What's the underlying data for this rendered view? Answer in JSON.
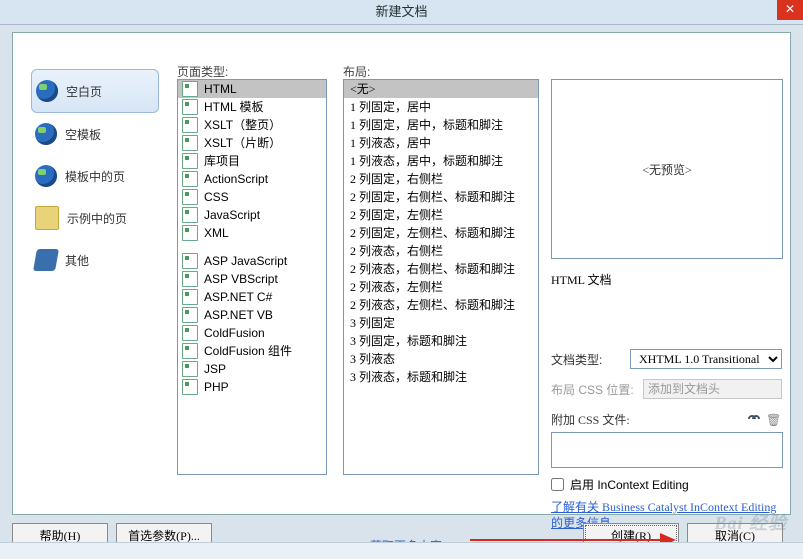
{
  "title": "新建文档",
  "categories": [
    {
      "label": "空白页",
      "icon": "globe",
      "selected": true
    },
    {
      "label": "空模板",
      "icon": "globe",
      "selected": false
    },
    {
      "label": "模板中的页",
      "icon": "globe",
      "selected": false
    },
    {
      "label": "示例中的页",
      "icon": "folder",
      "selected": false
    },
    {
      "label": "其他",
      "icon": "other",
      "selected": false
    }
  ],
  "pageTypeHeader": "页面类型:",
  "layoutHeader": "布局:",
  "pageTypes": {
    "group1": [
      "HTML",
      "HTML 模板",
      "XSLT（整页）",
      "XSLT（片断）",
      "库项目",
      "ActionScript",
      "CSS",
      "JavaScript",
      "XML"
    ],
    "group2": [
      "ASP JavaScript",
      "ASP VBScript",
      "ASP.NET C#",
      "ASP.NET VB",
      "ColdFusion",
      "ColdFusion 组件",
      "JSP",
      "PHP"
    ],
    "selected": "HTML"
  },
  "layouts": [
    "<无>",
    "1 列固定，居中",
    "1 列固定，居中，标题和脚注",
    "1 列液态，居中",
    "1 列液态，居中，标题和脚注",
    "2 列固定，右侧栏",
    "2 列固定，右侧栏、标题和脚注",
    "2 列固定，左侧栏",
    "2 列固定，左侧栏、标题和脚注",
    "2 列液态，右侧栏",
    "2 列液态，右侧栏、标题和脚注",
    "2 列液态，左侧栏",
    "2 列液态，左侧栏、标题和脚注",
    "3 列固定",
    "3 列固定，标题和脚注",
    "3 列液态",
    "3 列液态，标题和脚注"
  ],
  "layoutSelected": "<无>",
  "preview": {
    "text": "<无预览>"
  },
  "docLabel": "HTML 文档",
  "fields": {
    "docTypeLabel": "文档类型:",
    "docTypeValue": "XHTML 1.0 Transitional",
    "layoutCssLabel": "布局 CSS 位置:",
    "layoutCssValue": "添加到文档头",
    "attachCssLabel": "附加 CSS 文件:"
  },
  "checkbox": {
    "label": "启用 InContext Editing",
    "checked": false
  },
  "infoLink": "了解有关 Business Catalyst InContext Editing 的更多信息",
  "buttons": {
    "help": "帮助(H)",
    "prefs": "首选参数(P)...",
    "more": "获取更多内容...",
    "create": "创建(R)",
    "cancel": "取消(C)"
  },
  "watermark": "Bai 经验"
}
